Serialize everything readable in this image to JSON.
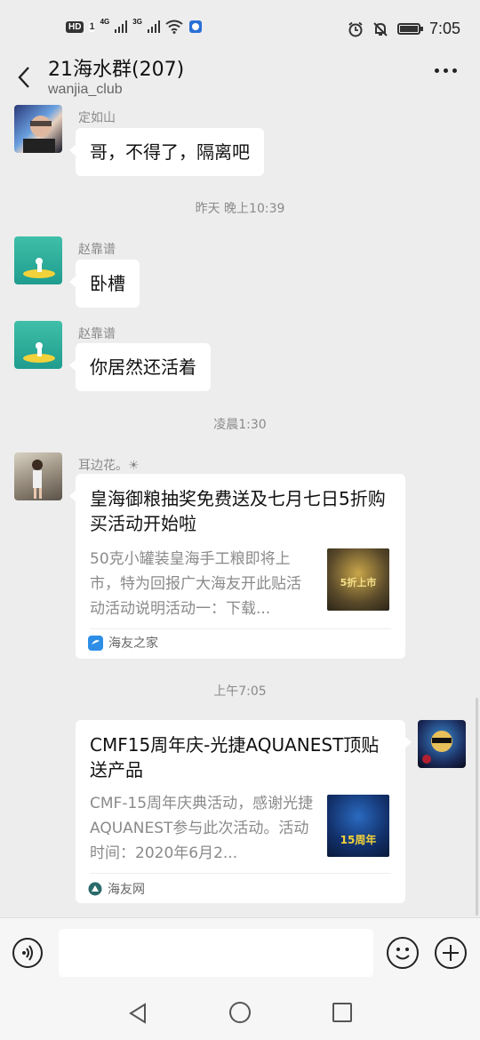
{
  "status": {
    "hd_label": "HD",
    "sim1_label": "1",
    "net1": "4G",
    "net2": "3G",
    "time": "7:05"
  },
  "header": {
    "title": "21海水群(207)",
    "subtitle": "wanjia_club"
  },
  "messages": [
    {
      "type": "text",
      "sender": "定如山",
      "text": "哥，不得了，隔离吧"
    },
    {
      "type": "time",
      "text": "昨天 晚上10:39"
    },
    {
      "type": "text",
      "sender": "赵靠谱",
      "text": "卧槽"
    },
    {
      "type": "text",
      "sender": "赵靠谱",
      "text": "你居然还活着"
    },
    {
      "type": "time",
      "text": "凌晨1:30"
    },
    {
      "type": "card",
      "sender": "耳边花。☀",
      "title": "皇海御粮抽奖免费送及七月七日5折购买活动开始啦",
      "description": "50克小罐装皇海手工粮即将上市，特为回报广大海友开此贴活动活动说明活动一：下载...",
      "thumb_text": "5折上市",
      "source": "海友之家"
    },
    {
      "type": "time",
      "text": "上午7:05"
    },
    {
      "type": "card",
      "sender": "",
      "title": "CMF15周年庆-光捷AQUANEST顶贴送产品",
      "description": "CMF-15周年庆典活动，感谢光捷AQUANEST参与此次活动。活动时间：2020年6月2...",
      "thumb_text": "15周年",
      "source": "海友网"
    }
  ],
  "input": {
    "placeholder": ""
  },
  "colors": {
    "background": "#ededed",
    "bubble": "#ffffff",
    "timestamp": "#8a8a8a"
  }
}
